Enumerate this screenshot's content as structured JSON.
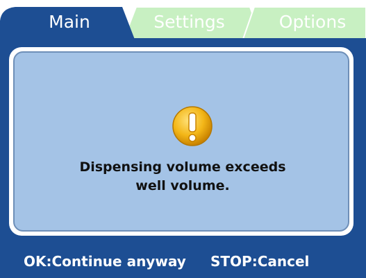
{
  "tabs": [
    {
      "label": "Main",
      "active": true
    },
    {
      "label": "Settings",
      "active": false
    },
    {
      "label": "Options",
      "active": false
    }
  ],
  "dialog": {
    "icon": "warning-exclamation-icon",
    "message_line1": "Dispensing volume exceeds",
    "message_line2": "well volume."
  },
  "hints": {
    "ok": "OK:Continue anyway",
    "stop": "STOP:Cancel"
  },
  "colors": {
    "frame_blue": "#1d4e93",
    "dialog_bg": "#a4c3e6",
    "inactive_tab": "#c8f0c2",
    "warning_yellow": "#f3b617"
  }
}
